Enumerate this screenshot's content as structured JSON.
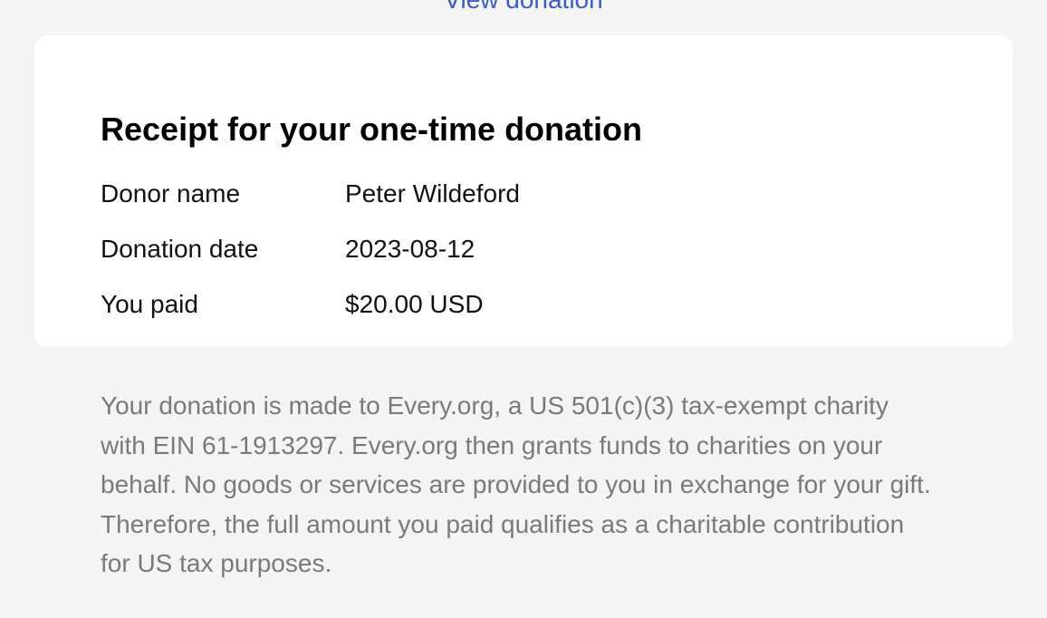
{
  "top_link": {
    "label": "View donation"
  },
  "receipt": {
    "title": "Receipt for your one-time donation",
    "rows": [
      {
        "label": "Donor name",
        "value": "Peter Wildeford"
      },
      {
        "label": "Donation date",
        "value": "2023-08-12"
      },
      {
        "label": "You paid",
        "value": "$20.00 USD"
      }
    ]
  },
  "disclaimer": {
    "text": "Your donation is made to Every.org, a US 501(c)(3) tax-exempt charity with EIN 61-1913297. Every.org then grants funds to charities on your behalf. No goods or services are provided to you in exchange for your gift. Therefore, the full amount you paid qualifies as a charitable contribution for US tax purposes."
  },
  "colors": {
    "page_background": "#f3f4f3",
    "card_background": "#ffffff",
    "link": "#3a5cc7",
    "muted_text": "#7a7a7a"
  }
}
